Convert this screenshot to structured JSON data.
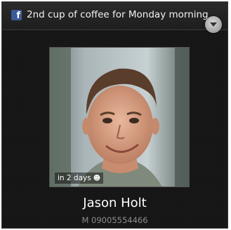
{
  "notification": {
    "app_icon": "facebook-icon",
    "app_glyph": "f",
    "status_text": "2nd cup of coffee for Monday morning",
    "dropdown_icon": "chevron-down-icon"
  },
  "photo": {
    "badge_text": "in 2 days",
    "badge_icon": "person-icon"
  },
  "contact": {
    "name": "Jason Holt",
    "phone": "M 09005554466"
  },
  "colors": {
    "background": "#141414",
    "facebook_blue": "#3b5998",
    "name_text": "#ffffff",
    "phone_text": "#8c8c8c"
  }
}
